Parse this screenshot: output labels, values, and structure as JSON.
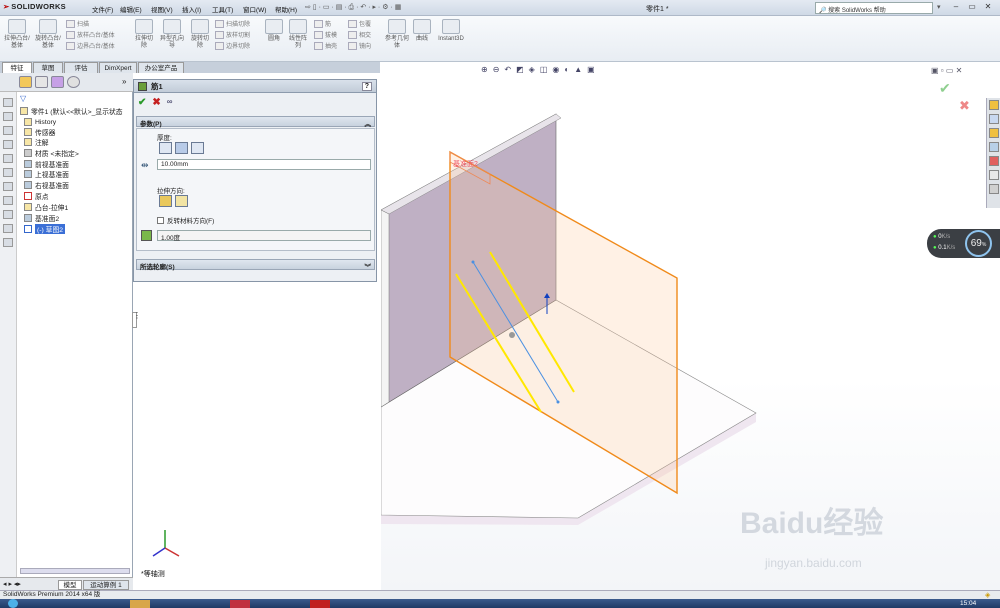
{
  "app": {
    "logo_text": "SOLIDWORKS",
    "menu": [
      "文件(F)",
      "编辑(E)",
      "视图(V)",
      "插入(I)",
      "工具(T)",
      "窗口(W)",
      "帮助(H)"
    ],
    "doc_title": "零件1 *",
    "help_search_placeholder": "搜索 SolidWorks 帮助"
  },
  "ribbon": {
    "big_buttons": [
      "拉伸凸台/基体",
      "旋转凸台/基体"
    ],
    "small_group1": [
      "扫描",
      "放样凸台/基体",
      "边界凸台/基体"
    ],
    "big_buttons2": [
      "拉伸切除",
      "异型孔向导",
      "旋转切除"
    ],
    "small_group2": [
      "扫描切除",
      "放样切割",
      "边界切除"
    ],
    "big_buttons3": [
      "圆角",
      "线性阵列"
    ],
    "small_group3": [
      "筋",
      "拔模",
      "抽壳"
    ],
    "small_group4": [
      "包覆",
      "相交",
      "镜向"
    ],
    "big_buttons4": [
      "参考几何体",
      "曲线",
      "Instant3D"
    ]
  },
  "tabs": [
    "特征",
    "草图",
    "评估",
    "DimXpert",
    "办公室产品"
  ],
  "tree": {
    "root": "零件1 (默认<<默认>_显示状态",
    "items": [
      "History",
      "传感器",
      "注解",
      "材质 <未指定>",
      "前视基准面",
      "上视基准面",
      "右视基准面",
      "原点",
      "凸台-拉伸1",
      "基准面2",
      "(-) 草图2"
    ],
    "bottom_tabs": [
      "模型",
      "运动算例 1"
    ]
  },
  "property_manager": {
    "title": "筋1",
    "help": "?",
    "params_header": "参数(P)",
    "thickness_label": "厚度:",
    "thickness_value": "10.00mm",
    "direction_label": "拉伸方向:",
    "flip_label": "反转材料方向(F)",
    "draft_value": "1.00度",
    "contours_header": "所选轮廓(S)"
  },
  "viewport": {
    "plane_label": "基准面2",
    "view_label": "*等轴测"
  },
  "gauge": {
    "percent": "69",
    "percent_unit": "%",
    "up_value": "0",
    "up_unit": "K/s",
    "down_value": "0.1",
    "down_unit": "K/s"
  },
  "status": {
    "text": "SolidWorks Premium 2014 x64 版",
    "time": "15:04"
  },
  "watermark": {
    "text": "Baidu经验",
    "url": "jingyan.baidu.com"
  }
}
